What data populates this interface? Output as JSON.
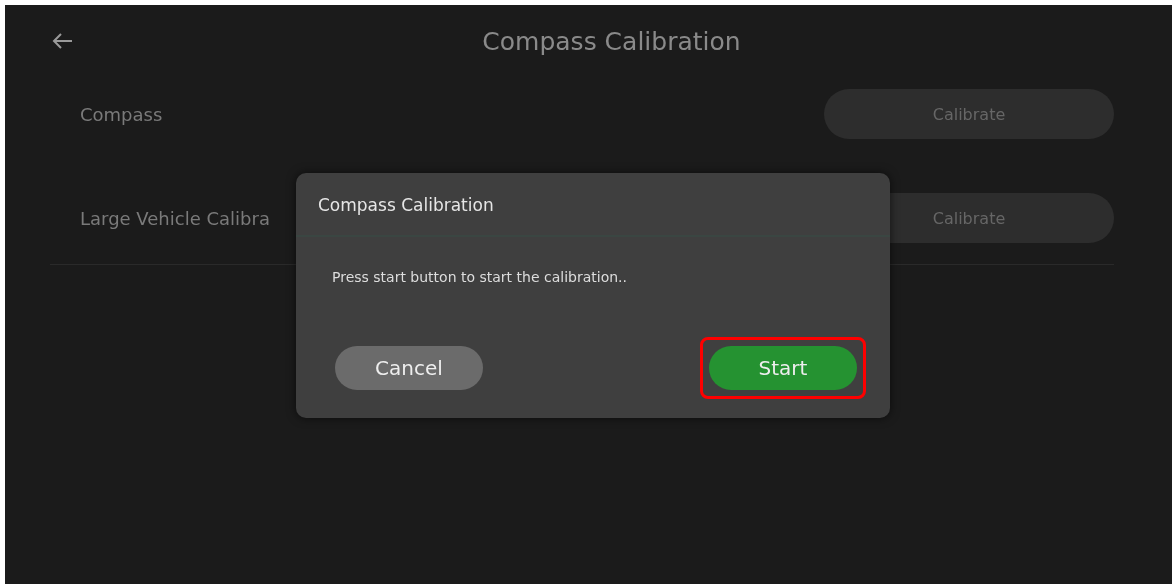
{
  "header": {
    "title": "Compass Calibration"
  },
  "rows": [
    {
      "label": "Compass",
      "button": "Calibrate"
    },
    {
      "label": "Large Vehicle Calibra",
      "button": "Calibrate"
    }
  ],
  "dialog": {
    "title": "Compass Calibration",
    "message": "Press start button to start the calibration..",
    "buttons": [
      {
        "label": "Cancel",
        "kind": "secondary",
        "highlighted": false
      },
      {
        "label": "Start",
        "kind": "primary",
        "highlighted": true
      }
    ]
  }
}
